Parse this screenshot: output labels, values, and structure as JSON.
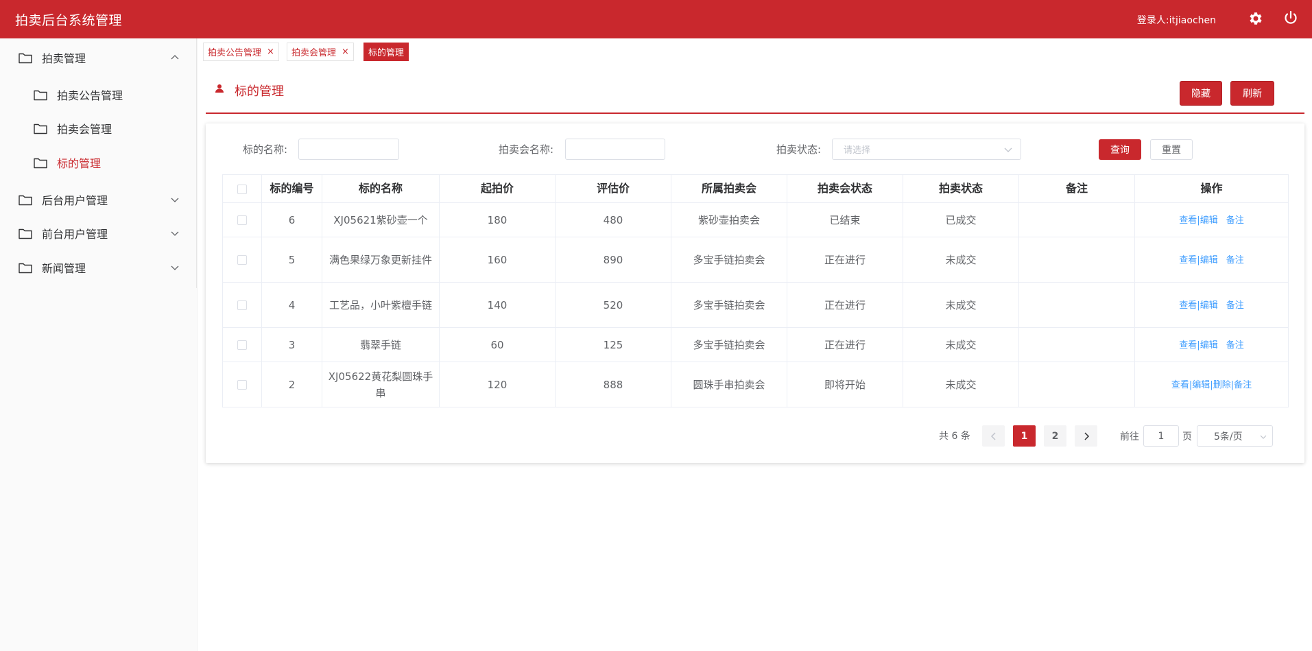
{
  "header": {
    "title": "拍卖后台系统管理",
    "login_user": "登录人:itjiaochen"
  },
  "sidebar": {
    "items": [
      {
        "label": "拍卖管理",
        "expanded": true
      },
      {
        "label": "拍卖公告管理"
      },
      {
        "label": "拍卖会管理"
      },
      {
        "label": "标的管理",
        "active": true
      },
      {
        "label": "后台用户管理",
        "expanded": false
      },
      {
        "label": "前台用户管理",
        "expanded": false
      },
      {
        "label": "新闻管理",
        "expanded": false
      }
    ]
  },
  "tabs": [
    {
      "label": "拍卖公告管理",
      "close": "×"
    },
    {
      "label": "拍卖会管理",
      "close": "×"
    },
    {
      "label": "标的管理",
      "active": true
    }
  ],
  "page": {
    "title": "标的管理",
    "hide_button": "隐藏",
    "refresh_button": "刷新"
  },
  "filters": {
    "item_name_label": "标的名称:",
    "item_name_value": "",
    "auction_name_label": "拍卖会名称:",
    "auction_name_value": "",
    "status_label": "拍卖状态:",
    "status_placeholder": "请选择",
    "query_button": "查询",
    "reset_button": "重置"
  },
  "table": {
    "columns": [
      "标的编号",
      "标的名称",
      "起拍价",
      "评估价",
      "所属拍卖会",
      "拍卖会状态",
      "拍卖状态",
      "备注",
      "操作"
    ],
    "rows": [
      {
        "id": "6",
        "name": "XJ05621紫砂壶一个",
        "start_price": "180",
        "appraisal": "480",
        "auction": "紫砂壶拍卖会",
        "auction_status": "已结束",
        "status": "已成交",
        "remark": "",
        "ops": [
          "查看",
          "编辑",
          "备注"
        ]
      },
      {
        "id": "5",
        "name": "满色果绿万象更新挂件",
        "start_price": "160",
        "appraisal": "890",
        "auction": "多宝手链拍卖会",
        "auction_status": "正在进行",
        "status": "未成交",
        "remark": "",
        "ops": [
          "查看",
          "编辑",
          "备注"
        ]
      },
      {
        "id": "4",
        "name": "工艺品，小叶紫檀手链",
        "start_price": "140",
        "appraisal": "520",
        "auction": "多宝手链拍卖会",
        "auction_status": "正在进行",
        "status": "未成交",
        "remark": "",
        "ops": [
          "查看",
          "编辑",
          "备注"
        ]
      },
      {
        "id": "3",
        "name": "翡翠手链",
        "start_price": "60",
        "appraisal": "125",
        "auction": "多宝手链拍卖会",
        "auction_status": "正在进行",
        "status": "未成交",
        "remark": "",
        "ops": [
          "查看",
          "编辑",
          "备注"
        ]
      },
      {
        "id": "2",
        "name": "XJ05622黄花梨圆珠手串",
        "start_price": "120",
        "appraisal": "888",
        "auction": "圆珠手串拍卖会",
        "auction_status": "即将开始",
        "status": "未成交",
        "remark": "",
        "ops": [
          "查看",
          "编辑",
          "删除",
          "备注"
        ]
      }
    ]
  },
  "pagination": {
    "total": "共 6 条",
    "pages": [
      "1",
      "2"
    ],
    "current_page": "1",
    "goto_label": "前往",
    "goto_value": "1",
    "page_label": "页",
    "page_size": "5条/页"
  },
  "colors": {
    "primary": "#c9282d",
    "link": "#409eff"
  }
}
